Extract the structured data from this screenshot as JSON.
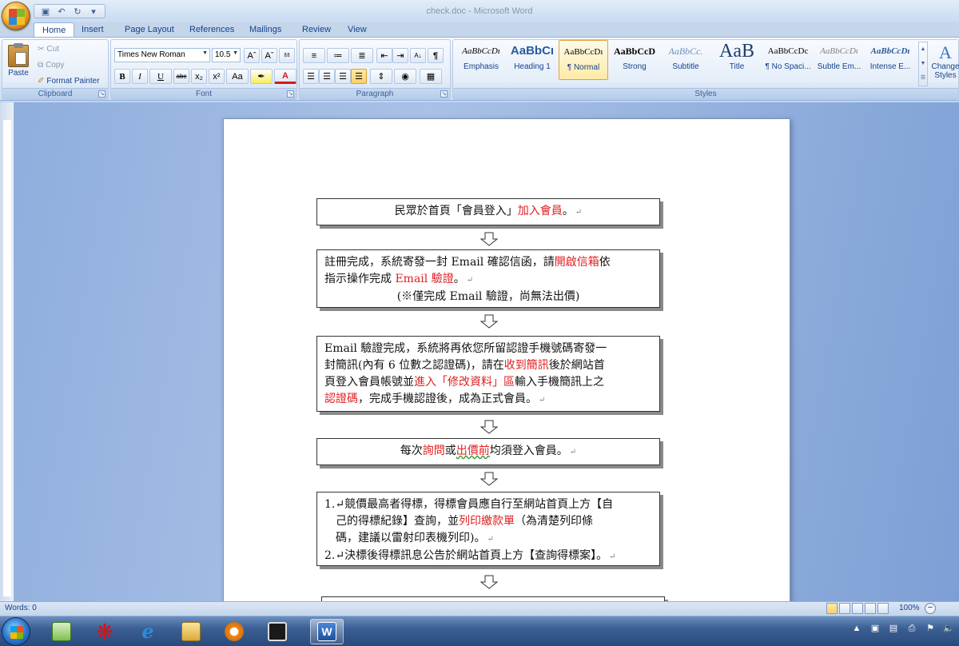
{
  "window": {
    "title": "check.doc - Microsoft Word"
  },
  "tabs": [
    "Home",
    "Insert",
    "Page Layout",
    "References",
    "Mailings",
    "Review",
    "View"
  ],
  "clipboard": {
    "paste": "Paste",
    "cut": "Cut",
    "copy": "Copy",
    "format_painter": "Format Painter",
    "label": "Clipboard"
  },
  "font": {
    "name": "Times New Roman",
    "size": "10.5",
    "label": "Font"
  },
  "paragraph": {
    "label": "Paragraph"
  },
  "styles": {
    "label": "Styles",
    "items": [
      {
        "sample": "AaBbCcDı",
        "name": "Emphasis"
      },
      {
        "sample": "AaBbCı",
        "name": "Heading 1"
      },
      {
        "sample": "AaBbCcDı",
        "name": "¶ Normal"
      },
      {
        "sample": "AaBbCcD",
        "name": "Strong"
      },
      {
        "sample": "AaBbCc.",
        "name": "Subtitle"
      },
      {
        "sample": "AaB",
        "name": "Title"
      },
      {
        "sample": "AaBbCcDc",
        "name": "¶ No Spaci..."
      },
      {
        "sample": "AaBbCcDı",
        "name": "Subtle Em..."
      },
      {
        "sample": "AaBbCcDı",
        "name": "Intense E..."
      }
    ],
    "change_styles_line1": "Change",
    "change_styles_line2": "Styles"
  },
  "document": {
    "box1": {
      "a": "民眾於首頁「會員登入」",
      "b": "加入會員",
      "c": "。"
    },
    "box2": {
      "l1a": "註冊完成，系統寄發一封 Email 確認信函，請",
      "l1b": "開啟信箱",
      "l1c": "依",
      "l2a": "指示操作完成 ",
      "l2b": "Email 驗證",
      "l2c": "。",
      "l3": "(※僅完成 Email 驗證，尚無法出價)"
    },
    "box3": {
      "l1": "Email 驗證完成，系統將再依您所留認證手機號碼寄發一",
      "l2a": "封簡訊(內有 6 位數之認證碼)，請在",
      "l2b": "收到簡訊",
      "l2c": "後於網站首",
      "l3a": "頁登入會員帳號並",
      "l3b": "進入「修改資料」區",
      "l3c": "輸入手機簡訊上之",
      "l4a": "認證碼",
      "l4b": "，完成手機認證後，成為正式會員。"
    },
    "box4": {
      "a": "每次",
      "b": "詢問",
      "c": "或",
      "d": "出價前",
      "e": "均須登入會員。"
    },
    "box5": {
      "l1": "1.↵競價最高者得標，得標會員應自行至網站首頁上方【自",
      "l2a": "己的得標紀錄】查詢，並",
      "l2b": "列印繳款單",
      "l2c": "（為清楚列印條",
      "l3": "碼，建議以雷射印表機列印)。",
      "l4": "2.↵決標後得標訊息公告於網站首頁上方【查詢得標案】。"
    }
  },
  "status": {
    "words": "Words: 0",
    "zoom": "100%"
  }
}
